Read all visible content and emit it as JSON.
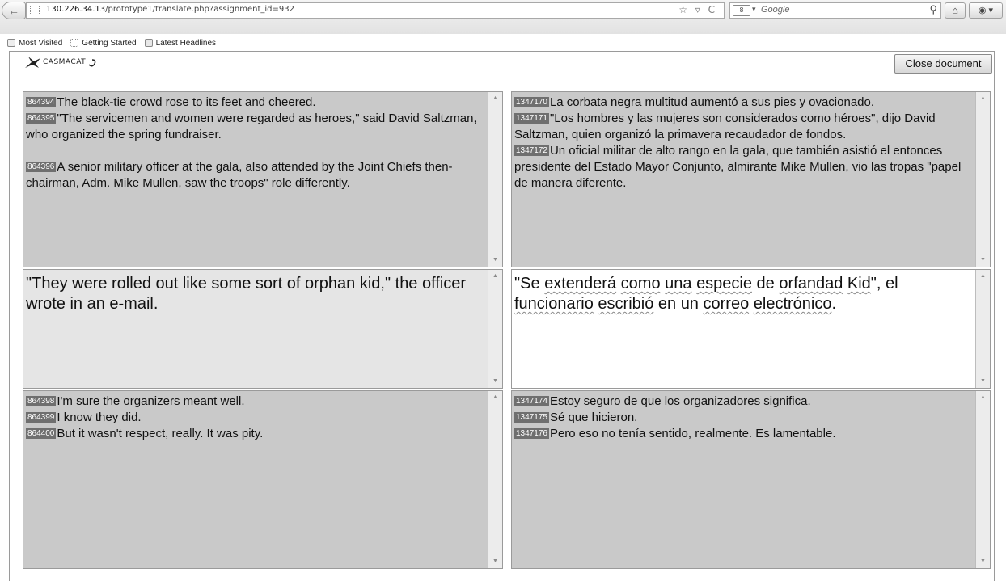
{
  "browser": {
    "url_prefix": "130.226.34.13",
    "url_path": "/prototype1/translate.php?assignment_id=932",
    "back_symbol": "←",
    "url_action_symbols": "☆ ▿ C",
    "search_placeholder": "Google",
    "search_engine_label": "8",
    "engine_arrow": "▾",
    "search_symbol": "⚲",
    "home_symbol": "⌂",
    "addon_symbol": "◉ ▾",
    "bookmarks": [
      "Most Visited",
      "Getting Started",
      "Latest Headlines"
    ]
  },
  "app": {
    "logo_text": "CASMACAT",
    "close_label": "Close document"
  },
  "scroll": {
    "up": "▲",
    "down": "▼"
  },
  "source": {
    "top": [
      {
        "id": "864394",
        "text": "The black-tie crowd rose to its feet and cheered."
      },
      {
        "id": "864395",
        "text": "\"The servicemen and women were regarded as heroes,\" said David Saltzman, who organized the spring fundraiser."
      },
      {
        "id": "864396",
        "text": "A senior military officer at the gala, also attended by the Joint Chiefs then-chairman, Adm. Mike Mullen, saw the troops\" role differently."
      }
    ],
    "current": "\"They were rolled out like some sort of orphan kid,\" the officer wrote in an e-mail.",
    "bottom": [
      {
        "id": "864398",
        "text": "I'm sure the organizers meant well."
      },
      {
        "id": "864399",
        "text": "I know they did."
      },
      {
        "id": "864400",
        "text": "But it wasn't respect, really. It was pity."
      }
    ]
  },
  "target": {
    "top": [
      {
        "id": "1347170",
        "text": "La corbata negra multitud aumentó a sus pies y ovacionado."
      },
      {
        "id": "1347171",
        "text": "\"Los hombres y las mujeres son considerados como héroes\", dijo David Saltzman, quien organizó la primavera recaudador de fondos."
      },
      {
        "id": "1347172",
        "text": "Un oficial militar de alto rango en la gala, que también asistió el entonces presidente del Estado Mayor Conjunto, almirante Mike Mullen, vio las tropas \"papel de manera diferente."
      }
    ],
    "current_parts": [
      "\"Se ",
      "extenderá",
      " ",
      "como",
      " ",
      "una",
      " ",
      "especie",
      " de ",
      "orfandad",
      " ",
      "Kid",
      "\", el ",
      "funcionario",
      " ",
      "escribió",
      " en un ",
      "correo",
      " ",
      "electrónico",
      "."
    ],
    "bottom": [
      {
        "id": "1347174",
        "text": "Estoy seguro de que los organizadores significa."
      },
      {
        "id": "1347175",
        "text": "Sé que hicieron."
      },
      {
        "id": "1347176",
        "text": "Pero eso no tenía sentido, realmente. Es lamentable."
      }
    ]
  }
}
